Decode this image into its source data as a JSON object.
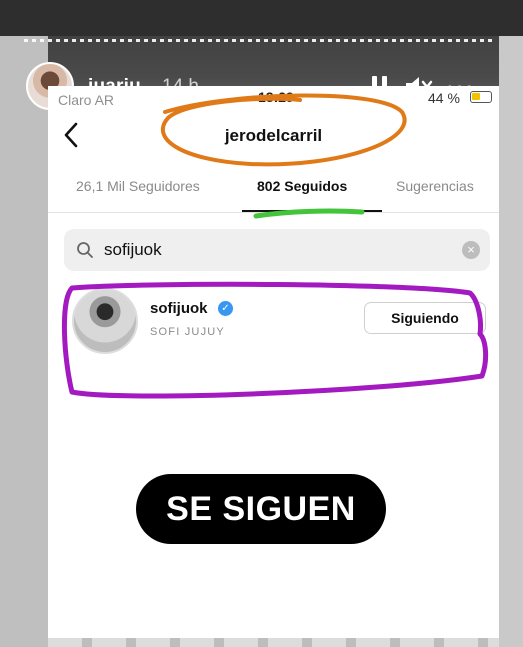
{
  "story": {
    "username": "juariu",
    "time_ago": "14 h",
    "more": "•••"
  },
  "phone_status": {
    "carrier": "Claro AR",
    "time": "18:29",
    "battery": "44 %"
  },
  "profile": {
    "username": "jerodelcarril"
  },
  "tabs": [
    {
      "label": "26,1 Mil Seguidores"
    },
    {
      "label": "802 Seguidos"
    },
    {
      "label": "Sugerencias"
    }
  ],
  "search": {
    "value": "sofijuok",
    "clear": "×"
  },
  "result": {
    "handle": "sofijuok",
    "full_name": "SOFI JUJUY",
    "verified_mark": "✓",
    "button_label": "Siguiendo"
  },
  "caption": "SE SIGUEN",
  "colors": {
    "orange_scribble": "#e07a18",
    "green_scribble": "#43c43b",
    "purple_scribble": "#a21ac0",
    "verified": "#3897f0"
  },
  "icons": [
    "back-chevron-icon",
    "search-icon",
    "clear-icon",
    "verified-badge-icon",
    "pause-icon",
    "mute-icon",
    "more-icon",
    "battery-icon"
  ]
}
